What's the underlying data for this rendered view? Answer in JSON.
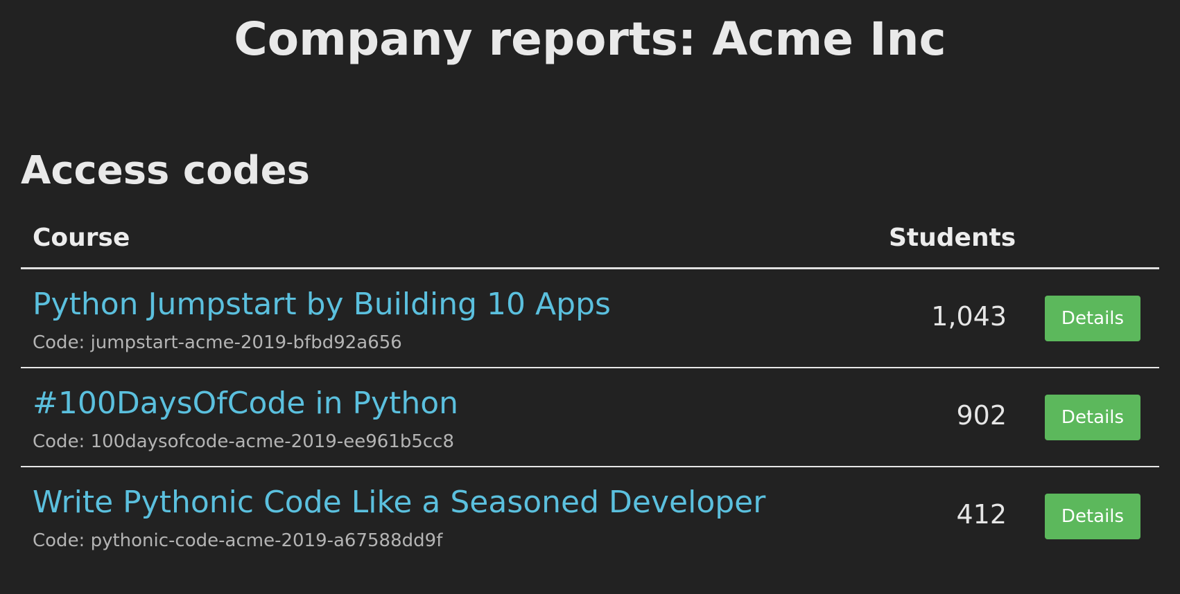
{
  "page": {
    "title": "Company reports: Acme Inc"
  },
  "section": {
    "title": "Access codes"
  },
  "table": {
    "headers": {
      "course": "Course",
      "students": "Students"
    },
    "rows": [
      {
        "course": "Python Jumpstart by Building 10 Apps",
        "code": "Code: jumpstart-acme-2019-bfbd92a656",
        "students": "1,043",
        "action": "Details"
      },
      {
        "course": "#100DaysOfCode in Python",
        "code": "Code: 100daysofcode-acme-2019-ee961b5cc8",
        "students": "902",
        "action": "Details"
      },
      {
        "course": "Write Pythonic Code Like a Seasoned Developer",
        "code": "Code: pythonic-code-acme-2019-a67588dd9f",
        "students": "412",
        "action": "Details"
      }
    ]
  },
  "colors": {
    "background": "#222222",
    "link": "#5bc0de",
    "button": "#5cb85c",
    "text": "#e6e6e6"
  }
}
